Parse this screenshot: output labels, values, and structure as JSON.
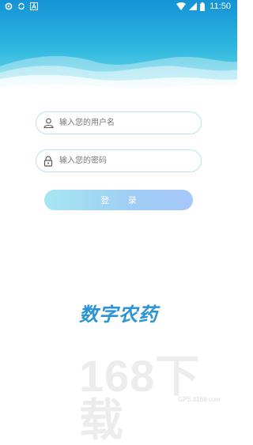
{
  "status_bar": {
    "time": "11:50",
    "icons": [
      "settings-icon",
      "sync-icon",
      "notification-a-icon",
      "wifi-icon",
      "signal-icon",
      "battery-icon"
    ]
  },
  "login_form": {
    "username_placeholder": "输入您的用户名",
    "password_placeholder": "输入您的密码",
    "login_label": "登 录"
  },
  "brand": {
    "title": "数字农药"
  },
  "watermark": {
    "big_text": "168下载",
    "small_text": "GPS.lt168.com"
  },
  "colors": {
    "header_top": "#1593d6",
    "header_mid": "#2cb6df",
    "field_border": "#b9e2ef",
    "button_start": "#a6e6f1",
    "button_end": "#a7c8fa",
    "brand_text": "#2c93d6"
  }
}
